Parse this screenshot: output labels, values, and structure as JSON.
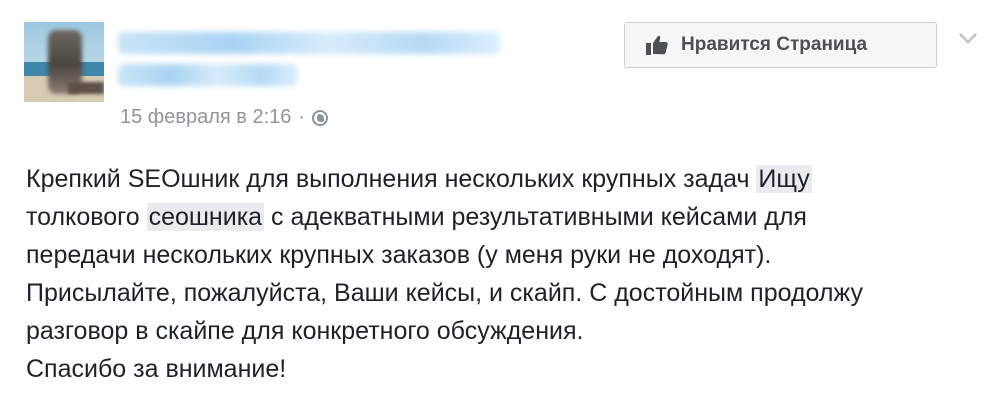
{
  "post": {
    "date": "15 февраля в 2:16",
    "separator": "·",
    "privacy_icon": "globe-icon",
    "body": {
      "line1_text": "Крепкий SEOшник для выполнения нескольких крупных задач ",
      "line1_tag": "Ищу",
      "line2_pre": "толкового ",
      "line2_tag": "сеошника",
      "line2_post": " с адекватными результативными кейсами для",
      "line3": "передачи нескольких крупных заказов (у меня руки не доходят).",
      "line4": "Присылайте, пожалуйста, Ваши кейсы, и скайп. С достойным продолжу",
      "line5": "разговор в скайпе для конкретного обсуждения.",
      "line6": "Спасибо за внимание!"
    }
  },
  "header": {
    "like_button_label": "Нравится Страница",
    "like_icon": "thumbs-up-icon",
    "menu_icon": "chevron-down-icon"
  },
  "colors": {
    "meta_text": "#90949c",
    "body_text": "#1d2129",
    "button_bg": "#f5f6f7",
    "button_text": "#4b4f56",
    "hashtag_bg": "#e9ebee"
  }
}
